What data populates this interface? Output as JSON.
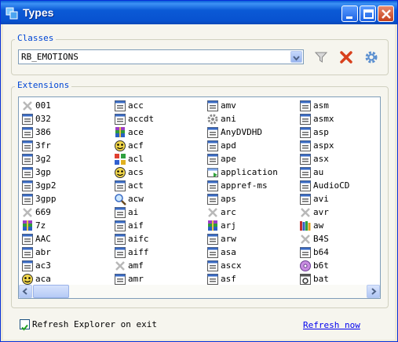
{
  "window": {
    "title": "Types"
  },
  "classes": {
    "label": "Classes",
    "selected": "RB_EMOTIONS",
    "filter_icon": "filter-icon",
    "delete_icon": "delete-x-icon",
    "settings_icon": "gear-icon"
  },
  "extensions": {
    "label": "Extensions",
    "columns": [
      [
        {
          "text": "001",
          "icon": "x"
        },
        {
          "text": "032",
          "icon": "file"
        },
        {
          "text": "386",
          "icon": "file"
        },
        {
          "text": "3fr",
          "icon": "file"
        },
        {
          "text": "3g2",
          "icon": "file"
        },
        {
          "text": "3gp",
          "icon": "file"
        },
        {
          "text": "3gp2",
          "icon": "file"
        },
        {
          "text": "3gpp",
          "icon": "file"
        },
        {
          "text": "669",
          "icon": "x"
        },
        {
          "text": "7z",
          "icon": "archive"
        },
        {
          "text": "AAC",
          "icon": "file"
        },
        {
          "text": "abr",
          "icon": "file"
        },
        {
          "text": "ac3",
          "icon": "file"
        },
        {
          "text": "aca",
          "icon": "face"
        }
      ],
      [
        {
          "text": "acc",
          "icon": "file"
        },
        {
          "text": "accdt",
          "icon": "file"
        },
        {
          "text": "ace",
          "icon": "archive"
        },
        {
          "text": "acf",
          "icon": "face"
        },
        {
          "text": "acl",
          "icon": "blocks"
        },
        {
          "text": "acs",
          "icon": "face"
        },
        {
          "text": "act",
          "icon": "file"
        },
        {
          "text": "acw",
          "icon": "magnifier"
        },
        {
          "text": "ai",
          "icon": "file"
        },
        {
          "text": "aif",
          "icon": "file"
        },
        {
          "text": "aifc",
          "icon": "file"
        },
        {
          "text": "aiff",
          "icon": "file"
        },
        {
          "text": "amf",
          "icon": "x"
        },
        {
          "text": "amr",
          "icon": "file"
        }
      ],
      [
        {
          "text": "amv",
          "icon": "file"
        },
        {
          "text": "ani",
          "icon": "gear"
        },
        {
          "text": "AnyDVDHD",
          "icon": "file"
        },
        {
          "text": "apd",
          "icon": "file"
        },
        {
          "text": "ape",
          "icon": "file"
        },
        {
          "text": "application",
          "icon": "app"
        },
        {
          "text": "appref-ms",
          "icon": "file"
        },
        {
          "text": "aps",
          "icon": "file"
        },
        {
          "text": "arc",
          "icon": "x"
        },
        {
          "text": "arj",
          "icon": "archive"
        },
        {
          "text": "arw",
          "icon": "file"
        },
        {
          "text": "asa",
          "icon": "file"
        },
        {
          "text": "ascx",
          "icon": "file"
        },
        {
          "text": "asf",
          "icon": "file"
        }
      ],
      [
        {
          "text": "asm",
          "icon": "file"
        },
        {
          "text": "asmx",
          "icon": "file"
        },
        {
          "text": "asp",
          "icon": "file"
        },
        {
          "text": "aspx",
          "icon": "file"
        },
        {
          "text": "asx",
          "icon": "file"
        },
        {
          "text": "au",
          "icon": "file"
        },
        {
          "text": "AudioCD",
          "icon": "file"
        },
        {
          "text": "avi",
          "icon": "file"
        },
        {
          "text": "avr",
          "icon": "x"
        },
        {
          "text": "aw",
          "icon": "books"
        },
        {
          "text": "B4S",
          "icon": "x"
        },
        {
          "text": "b64",
          "icon": "file"
        },
        {
          "text": "b6t",
          "icon": "disc"
        },
        {
          "text": "bat",
          "icon": "batch"
        }
      ]
    ]
  },
  "footer": {
    "checkbox_label": "Refresh Explorer on exit",
    "checked": true,
    "refresh_link": "Refresh now"
  },
  "colors": {
    "titlebar": "#0a5fd8",
    "legend": "#0046d5",
    "link": "#0000ee"
  }
}
